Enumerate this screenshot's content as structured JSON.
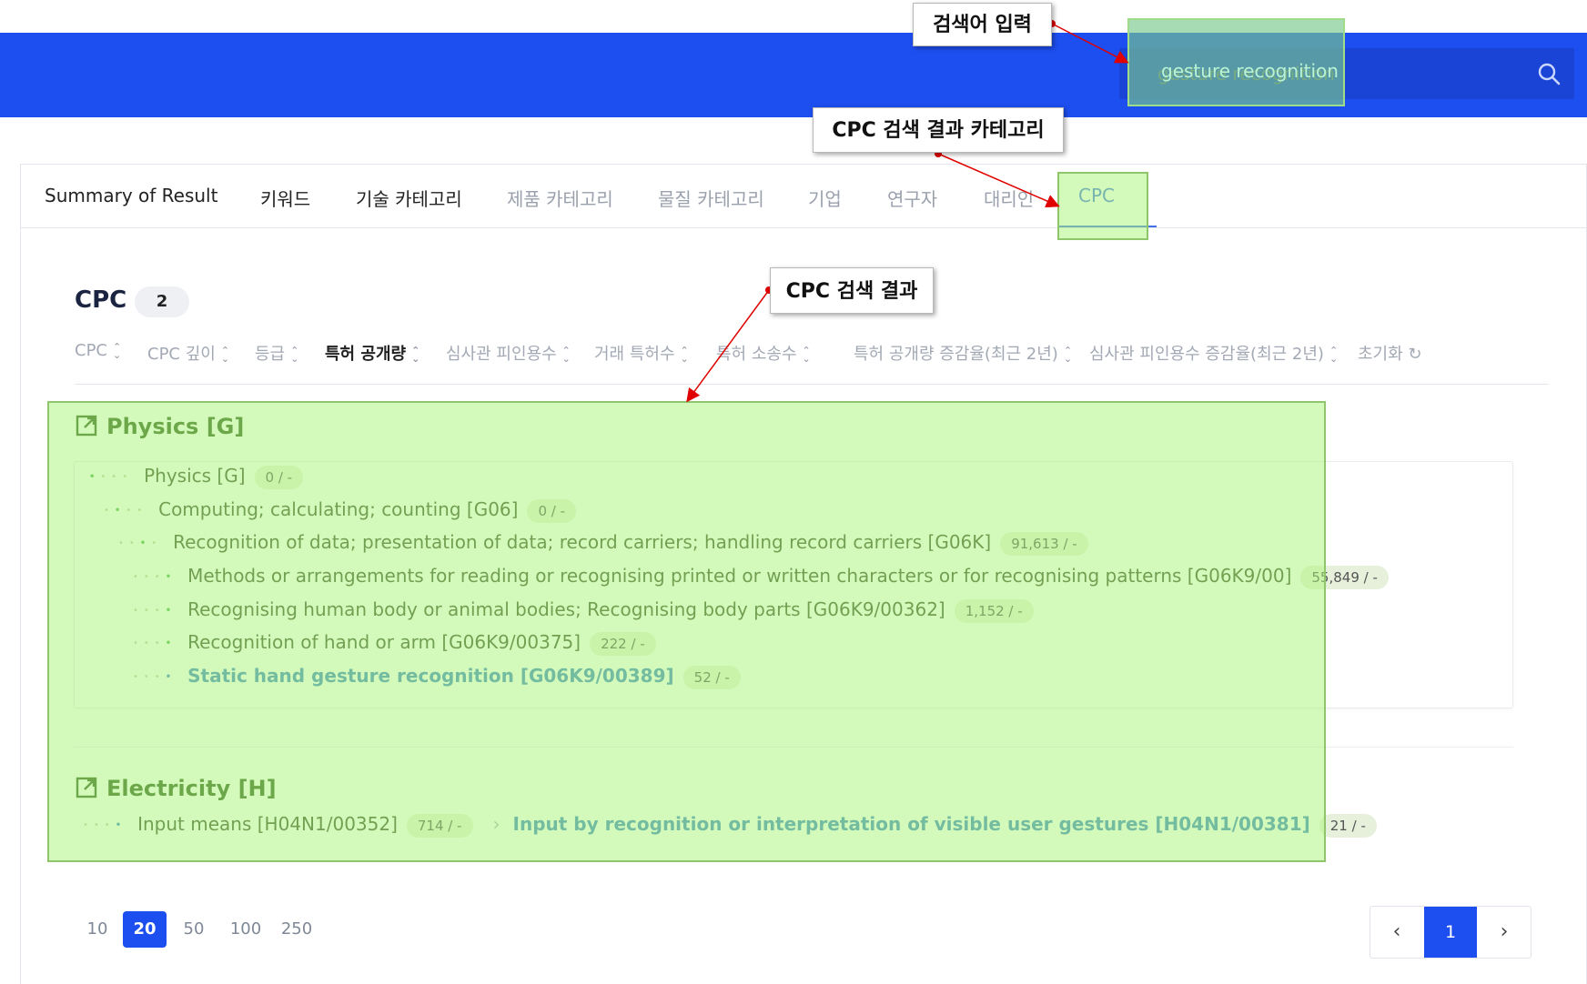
{
  "search": {
    "placeholder": "gesture recognition"
  },
  "tabs": [
    {
      "label": "Summary of Result"
    },
    {
      "label": "키워드"
    },
    {
      "label": "기술 카테고리"
    },
    {
      "label": "제품 카테고리"
    },
    {
      "label": "물질 카테고리"
    },
    {
      "label": "기업"
    },
    {
      "label": "연구자"
    },
    {
      "label": "대리인"
    },
    {
      "label": "CPC"
    }
  ],
  "section": {
    "title": "CPC",
    "count": "2"
  },
  "sort_options": [
    {
      "label": "CPC"
    },
    {
      "label": "CPC 깊이"
    },
    {
      "label": "등급"
    },
    {
      "label": "특허 공개량"
    },
    {
      "label": "심사관 피인용수"
    },
    {
      "label": "거래 특허수"
    },
    {
      "label": "특허 소송수"
    },
    {
      "label": "특허 공개량 증감율(최근 2년)"
    },
    {
      "label": "심사관 피인용수 증감율(최근 2년)"
    },
    {
      "label": "초기화"
    }
  ],
  "groups": [
    {
      "title": "Physics [G]",
      "rows": [
        {
          "label": "Physics [G]",
          "stat": "0 / -"
        },
        {
          "label": "Computing; calculating; counting [G06]",
          "stat": "0 / -"
        },
        {
          "label": "Recognition of data; presentation of data; record carriers; handling record carriers [G06K]",
          "stat": "91,613 / -"
        },
        {
          "label": "Methods or arrangements for reading or recognising printed or written characters or for recognising patterns [G06K9/00]",
          "stat": "55,849 / -"
        },
        {
          "label": "Recognising human body or animal bodies; Recognising body parts [G06K9/00362]",
          "stat": "1,152 / -"
        },
        {
          "label": "Recognition of hand or arm [G06K9/00375]",
          "stat": "222 / -"
        },
        {
          "label": "Static hand gesture recognition [G06K9/00389]",
          "stat": "52 / -"
        }
      ]
    },
    {
      "title": "Electricity [H]",
      "rows": [
        {
          "label": "Input means [H04N1/00352]",
          "stat": "714 / -"
        },
        {
          "label": "Input by recognition or interpretation of visible user gestures [H04N1/00381]",
          "stat": "21 / -"
        }
      ]
    }
  ],
  "annotations": {
    "search_input": "검색어 입력",
    "cpc_category": "CPC 검색 결과 카테고리",
    "cpc_results": "CPC 검색 결과"
  },
  "pagination": {
    "sizes": [
      "10",
      "20",
      "50",
      "100",
      "250"
    ],
    "selected_size": "20",
    "current_page": "1",
    "prev_icon": "chevron-left-icon",
    "next_icon": "chevron-right-icon"
  },
  "colors": {
    "header_blue": "#1d4ef0",
    "highlight_green": "#aaf578",
    "link_blue": "#3d83c8",
    "annotation_red": "#e00000"
  }
}
